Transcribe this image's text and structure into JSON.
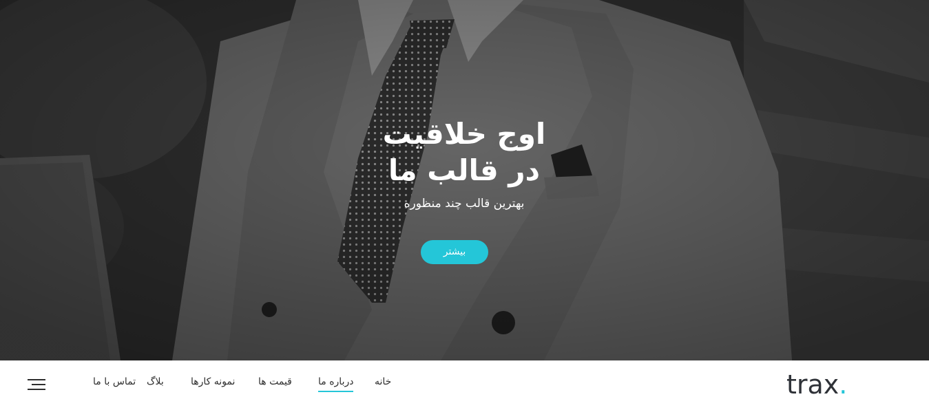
{
  "hero": {
    "title_line1": "اوج خلاقیت",
    "title_line2": "در قالب ما",
    "subtitle": "بهترین قالب چند منظوره",
    "button_label": "بیشتر"
  },
  "nav": {
    "logo_text": "trax",
    "logo_dot": ".",
    "items": [
      {
        "label": "خانه"
      },
      {
        "label": "درباره ما",
        "active": true
      },
      {
        "label": "قیمت ها"
      },
      {
        "label": "نمونه کارها"
      },
      {
        "label": "بلاگ"
      },
      {
        "label": "تماس با ما"
      }
    ],
    "menu_icon": "hamburger-menu-icon"
  },
  "colors": {
    "accent": "#24c6d8",
    "nav_text": "#2e2e2e",
    "hero_overlay": "#2a2a2a"
  }
}
